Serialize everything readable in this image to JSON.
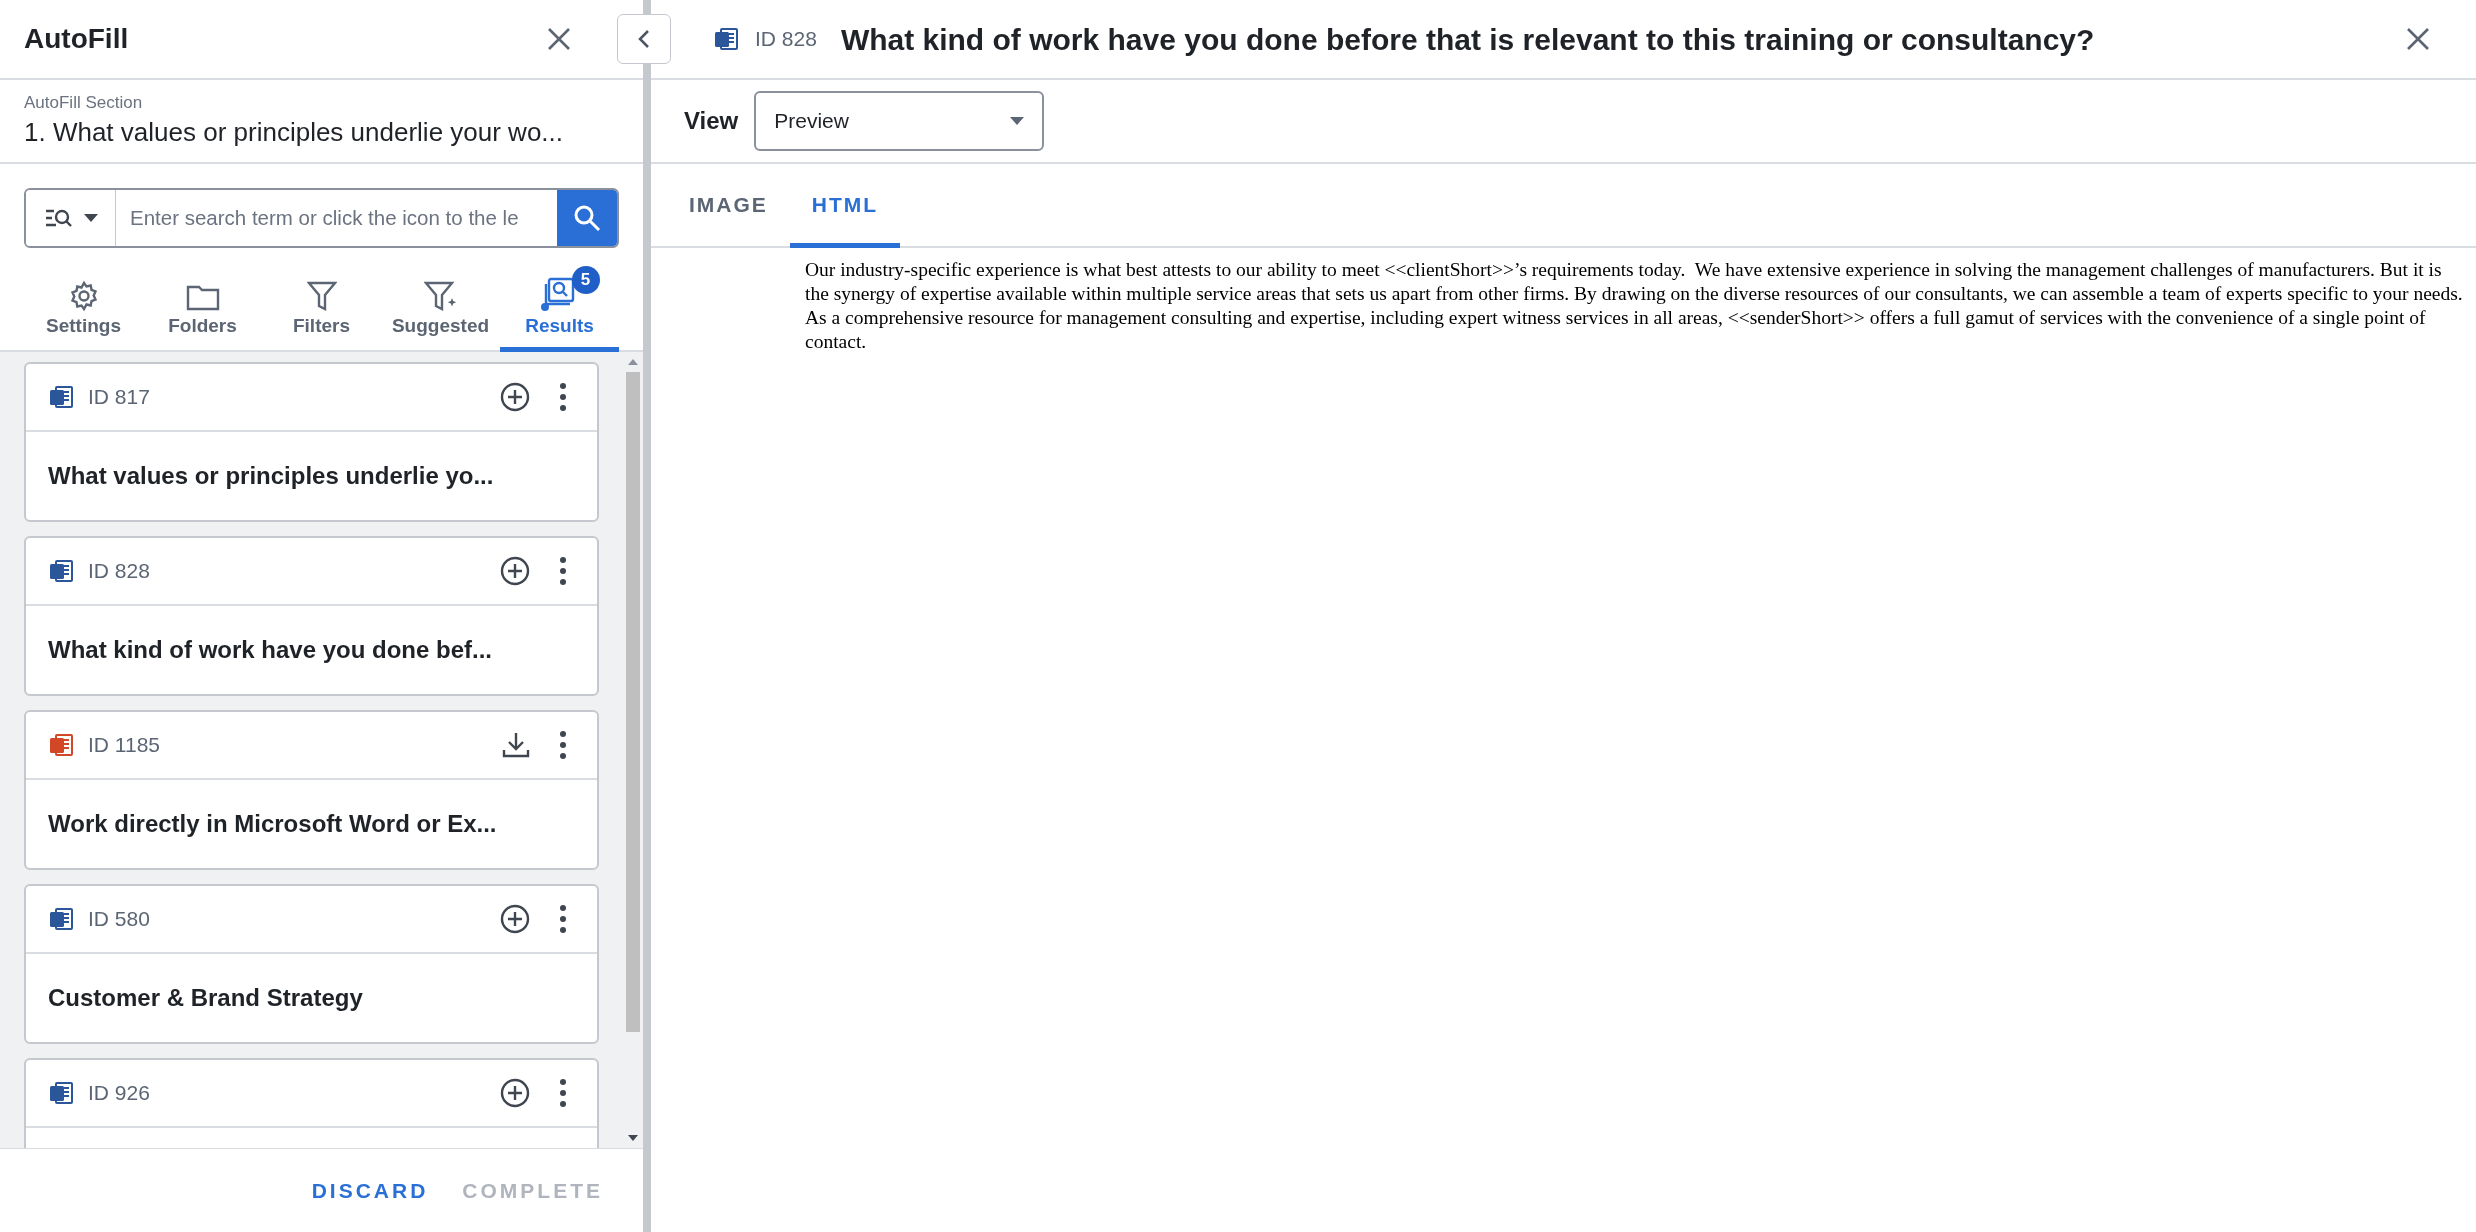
{
  "sidebar": {
    "title": "AutoFill",
    "section_label": "AutoFill Section",
    "section_title": "1. What values or principles underlie your wo...",
    "search": {
      "placeholder": "Enter search term or click the icon to the le"
    },
    "tabs": [
      {
        "kind": "settings",
        "label": "Settings",
        "selected": false
      },
      {
        "kind": "folders",
        "label": "Folders",
        "selected": false
      },
      {
        "kind": "filters",
        "label": "Filters",
        "selected": false
      },
      {
        "kind": "suggested",
        "label": "Suggested",
        "selected": false
      },
      {
        "kind": "results",
        "label": "Results",
        "selected": true,
        "badge": "5"
      }
    ],
    "results": [
      {
        "file_icon": {
          "kind": "word"
        },
        "id": "ID 817",
        "action_button": {
          "kind": "add"
        },
        "title": "What values or principles underlie yo..."
      },
      {
        "file_icon": {
          "kind": "word"
        },
        "id": "ID 828",
        "action_button": {
          "kind": "add"
        },
        "title": "What kind of work have you done bef..."
      },
      {
        "file_icon": {
          "kind": "powerpoint"
        },
        "id": "ID 1185",
        "action_button": {
          "kind": "download"
        },
        "title": "Work directly in Microsoft Word or Ex..."
      },
      {
        "file_icon": {
          "kind": "word"
        },
        "id": "ID 580",
        "action_button": {
          "kind": "add"
        },
        "title": "Customer & Brand Strategy"
      },
      {
        "file_icon": {
          "kind": "word"
        },
        "id": "ID 926",
        "action_button": {
          "kind": "add"
        }
      }
    ],
    "footer_buttons": [
      {
        "label": "DISCARD",
        "disabled": false
      },
      {
        "label": "COMPLETE",
        "disabled": true
      }
    ]
  },
  "document": {
    "file_icon": {
      "kind": "word"
    },
    "id": "ID 828",
    "title": "What kind of work have you done before that is relevant to this training or consultancy?",
    "view": {
      "label": "View",
      "value": "Preview"
    },
    "tabs": [
      {
        "label": "IMAGE",
        "selected": false
      },
      {
        "label": "HTML",
        "selected": true
      }
    ],
    "content": "Our industry-specific experience is what best attests to our ability to meet <<clientShort>>’s requirements today.  We have extensive experience in solving the management challenges of manufacturers. But it is the synergy of expertise available within multiple service areas that sets us apart from other firms. By drawing on the diverse resources of our consultants, we can assemble a team of experts specific to your needs. As a comprehensive resource for management consulting and expertise, including expert witness services in all areas, <<senderShort>> offers a full gamut of services with the convenience of a single point of contact."
  }
}
